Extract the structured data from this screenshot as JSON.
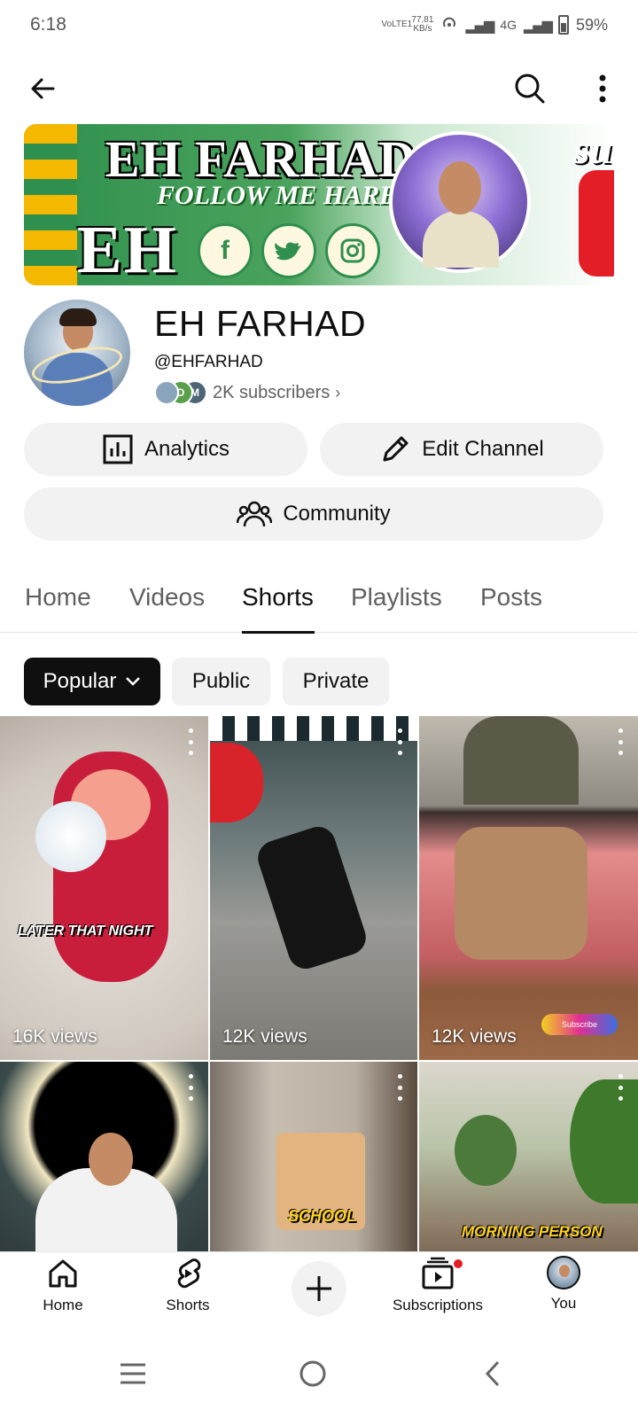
{
  "status_bar": {
    "time": "6:18",
    "volte": "VoLTE1",
    "speed_value": "77.81",
    "speed_unit": "KB/s",
    "network": "4G",
    "battery": "59%"
  },
  "banner": {
    "title": "EH FARHAD",
    "follow_text": "FOLLOW ME HARE",
    "logo_text": "EH",
    "corner_text": "su",
    "socials": [
      "facebook-icon",
      "twitter-icon",
      "instagram-icon"
    ]
  },
  "channel": {
    "name": "EH FARHAD",
    "handle": "@EHFARHAD",
    "subscribers": "2K subscribers",
    "mini_avatar_letters": [
      "",
      "D",
      "M"
    ]
  },
  "actions": {
    "analytics_label": "Analytics",
    "edit_label": "Edit Channel",
    "community_label": "Community"
  },
  "tabs": [
    {
      "label": "Home",
      "active": false
    },
    {
      "label": "Videos",
      "active": false
    },
    {
      "label": "Shorts",
      "active": true
    },
    {
      "label": "Playlists",
      "active": false
    },
    {
      "label": "Posts",
      "active": false
    }
  ],
  "chips": {
    "popular": "Popular",
    "public": "Public",
    "private": "Private"
  },
  "shorts": [
    {
      "views": "16K views",
      "caption": "LATER THAT NIGHT"
    },
    {
      "views": "12K views",
      "caption": ""
    },
    {
      "views": "12K views",
      "caption": "",
      "badge": "Subscribe"
    },
    {
      "views": "",
      "caption": ""
    },
    {
      "views": "",
      "caption": "SCHOOL"
    },
    {
      "views": "",
      "caption": "MORNING PERSON"
    }
  ],
  "bottom_nav": {
    "home": "Home",
    "shorts": "Shorts",
    "subscriptions": "Subscriptions",
    "you": "You"
  },
  "colors": {
    "accent": "#0f0f0f",
    "chip_bg": "#f2f2f2",
    "notification": "#e41e26"
  }
}
